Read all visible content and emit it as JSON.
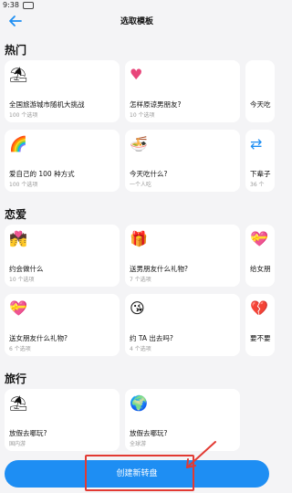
{
  "status_bar": {
    "time": "9:38"
  },
  "header": {
    "title": "选取模板"
  },
  "sections": [
    {
      "title": "热门"
    },
    {
      "title": "恋爱"
    },
    {
      "title": "旅行"
    }
  ],
  "cards": {
    "hot_row1": [
      {
        "icon": "beach-umbrella-icon",
        "title": "全国旅游城市随机大挑战",
        "subtitle": "100 个选项"
      },
      {
        "icon": "heart-icon",
        "title": "怎样原谅男朋友?",
        "subtitle": "10 个选项"
      },
      {
        "icon": "unknown-icon",
        "title": "今天吃",
        "subtitle": ""
      }
    ],
    "hot_row2": [
      {
        "icon": "rainbow-icon",
        "title": "爱自己的 100 种方式",
        "subtitle": "100 个选项"
      },
      {
        "icon": "food-bowl-icon",
        "title": "今天吃什么?",
        "subtitle": "一个人吃"
      },
      {
        "icon": "repeat-icon",
        "title": "下辈子",
        "subtitle": "36 个"
      }
    ],
    "love_row1": [
      {
        "icon": "kissing-couple-icon",
        "title": "约会做什么",
        "subtitle": "10 个选项"
      },
      {
        "icon": "gift-icon",
        "title": "送男朋友什么礼物?",
        "subtitle": "7 个选项"
      },
      {
        "icon": "heart-gift-icon",
        "title": "给女朋",
        "subtitle": ""
      }
    ],
    "love_row2": [
      {
        "icon": "gift-heart-icon",
        "title": "送女朋友什么礼物?",
        "subtitle": "6 个选项"
      },
      {
        "icon": "kiss-face-icon",
        "title": "约 TA 出去吗?",
        "subtitle": "4 个选项"
      },
      {
        "icon": "broken-heart-icon",
        "title": "要不要",
        "subtitle": ""
      }
    ],
    "travel_row1": [
      {
        "icon": "beach-umbrella-icon",
        "title": "放假去哪玩?",
        "subtitle": "国内游"
      },
      {
        "icon": "globe-icon",
        "title": "放假去哪玩?",
        "subtitle": "全球游"
      }
    ]
  },
  "bottom": {
    "button_label": "创建新转盘"
  }
}
